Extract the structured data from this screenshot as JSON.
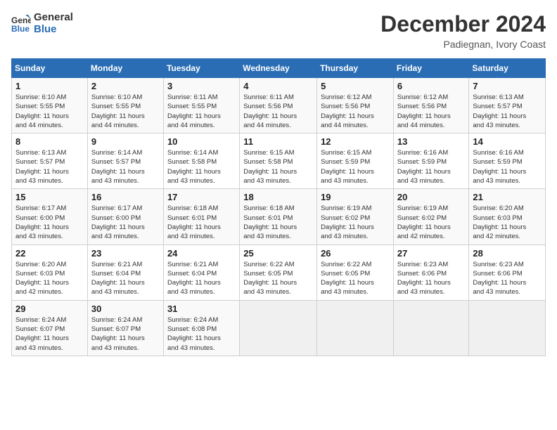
{
  "header": {
    "logo_line1": "General",
    "logo_line2": "Blue",
    "month_year": "December 2024",
    "location": "Padiegnan, Ivory Coast"
  },
  "days_of_week": [
    "Sunday",
    "Monday",
    "Tuesday",
    "Wednesday",
    "Thursday",
    "Friday",
    "Saturday"
  ],
  "weeks": [
    [
      {
        "day": "1",
        "info": "Sunrise: 6:10 AM\nSunset: 5:55 PM\nDaylight: 11 hours\nand 44 minutes."
      },
      {
        "day": "2",
        "info": "Sunrise: 6:10 AM\nSunset: 5:55 PM\nDaylight: 11 hours\nand 44 minutes."
      },
      {
        "day": "3",
        "info": "Sunrise: 6:11 AM\nSunset: 5:55 PM\nDaylight: 11 hours\nand 44 minutes."
      },
      {
        "day": "4",
        "info": "Sunrise: 6:11 AM\nSunset: 5:56 PM\nDaylight: 11 hours\nand 44 minutes."
      },
      {
        "day": "5",
        "info": "Sunrise: 6:12 AM\nSunset: 5:56 PM\nDaylight: 11 hours\nand 44 minutes."
      },
      {
        "day": "6",
        "info": "Sunrise: 6:12 AM\nSunset: 5:56 PM\nDaylight: 11 hours\nand 44 minutes."
      },
      {
        "day": "7",
        "info": "Sunrise: 6:13 AM\nSunset: 5:57 PM\nDaylight: 11 hours\nand 43 minutes."
      }
    ],
    [
      {
        "day": "8",
        "info": "Sunrise: 6:13 AM\nSunset: 5:57 PM\nDaylight: 11 hours\nand 43 minutes."
      },
      {
        "day": "9",
        "info": "Sunrise: 6:14 AM\nSunset: 5:57 PM\nDaylight: 11 hours\nand 43 minutes."
      },
      {
        "day": "10",
        "info": "Sunrise: 6:14 AM\nSunset: 5:58 PM\nDaylight: 11 hours\nand 43 minutes."
      },
      {
        "day": "11",
        "info": "Sunrise: 6:15 AM\nSunset: 5:58 PM\nDaylight: 11 hours\nand 43 minutes."
      },
      {
        "day": "12",
        "info": "Sunrise: 6:15 AM\nSunset: 5:59 PM\nDaylight: 11 hours\nand 43 minutes."
      },
      {
        "day": "13",
        "info": "Sunrise: 6:16 AM\nSunset: 5:59 PM\nDaylight: 11 hours\nand 43 minutes."
      },
      {
        "day": "14",
        "info": "Sunrise: 6:16 AM\nSunset: 5:59 PM\nDaylight: 11 hours\nand 43 minutes."
      }
    ],
    [
      {
        "day": "15",
        "info": "Sunrise: 6:17 AM\nSunset: 6:00 PM\nDaylight: 11 hours\nand 43 minutes."
      },
      {
        "day": "16",
        "info": "Sunrise: 6:17 AM\nSunset: 6:00 PM\nDaylight: 11 hours\nand 43 minutes."
      },
      {
        "day": "17",
        "info": "Sunrise: 6:18 AM\nSunset: 6:01 PM\nDaylight: 11 hours\nand 43 minutes."
      },
      {
        "day": "18",
        "info": "Sunrise: 6:18 AM\nSunset: 6:01 PM\nDaylight: 11 hours\nand 43 minutes."
      },
      {
        "day": "19",
        "info": "Sunrise: 6:19 AM\nSunset: 6:02 PM\nDaylight: 11 hours\nand 43 minutes."
      },
      {
        "day": "20",
        "info": "Sunrise: 6:19 AM\nSunset: 6:02 PM\nDaylight: 11 hours\nand 42 minutes."
      },
      {
        "day": "21",
        "info": "Sunrise: 6:20 AM\nSunset: 6:03 PM\nDaylight: 11 hours\nand 42 minutes."
      }
    ],
    [
      {
        "day": "22",
        "info": "Sunrise: 6:20 AM\nSunset: 6:03 PM\nDaylight: 11 hours\nand 42 minutes."
      },
      {
        "day": "23",
        "info": "Sunrise: 6:21 AM\nSunset: 6:04 PM\nDaylight: 11 hours\nand 43 minutes."
      },
      {
        "day": "24",
        "info": "Sunrise: 6:21 AM\nSunset: 6:04 PM\nDaylight: 11 hours\nand 43 minutes."
      },
      {
        "day": "25",
        "info": "Sunrise: 6:22 AM\nSunset: 6:05 PM\nDaylight: 11 hours\nand 43 minutes."
      },
      {
        "day": "26",
        "info": "Sunrise: 6:22 AM\nSunset: 6:05 PM\nDaylight: 11 hours\nand 43 minutes."
      },
      {
        "day": "27",
        "info": "Sunrise: 6:23 AM\nSunset: 6:06 PM\nDaylight: 11 hours\nand 43 minutes."
      },
      {
        "day": "28",
        "info": "Sunrise: 6:23 AM\nSunset: 6:06 PM\nDaylight: 11 hours\nand 43 minutes."
      }
    ],
    [
      {
        "day": "29",
        "info": "Sunrise: 6:24 AM\nSunset: 6:07 PM\nDaylight: 11 hours\nand 43 minutes."
      },
      {
        "day": "30",
        "info": "Sunrise: 6:24 AM\nSunset: 6:07 PM\nDaylight: 11 hours\nand 43 minutes."
      },
      {
        "day": "31",
        "info": "Sunrise: 6:24 AM\nSunset: 6:08 PM\nDaylight: 11 hours\nand 43 minutes."
      },
      {
        "day": "",
        "info": ""
      },
      {
        "day": "",
        "info": ""
      },
      {
        "day": "",
        "info": ""
      },
      {
        "day": "",
        "info": ""
      }
    ]
  ]
}
